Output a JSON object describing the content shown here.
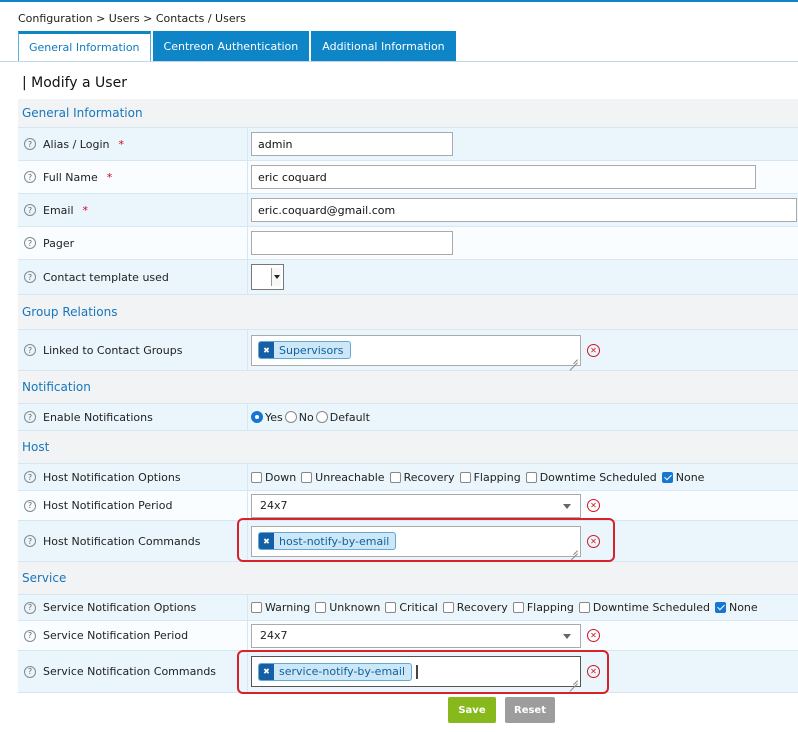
{
  "breadcrumb": "Configuration > Users > Contacts / Users",
  "tabs": [
    {
      "label": "General Information"
    },
    {
      "label": "Centreon Authentication"
    },
    {
      "label": "Additional Information"
    }
  ],
  "page_title": "| Modify a User",
  "sections": {
    "general": "General Information",
    "group": "Group Relations",
    "notification": "Notification",
    "host": "Host",
    "service": "Service"
  },
  "fields": {
    "alias": {
      "label": "Alias / Login",
      "value": "admin",
      "required": "*"
    },
    "full_name": {
      "label": "Full Name",
      "value": "eric coquard",
      "required": "*"
    },
    "email": {
      "label": "Email",
      "value": "eric.coquard@gmail.com",
      "required": "*"
    },
    "pager": {
      "label": "Pager",
      "value": ""
    },
    "template": {
      "label": "Contact template used"
    },
    "contact_groups": {
      "label": "Linked to Contact Groups",
      "tag": "Supervisors"
    },
    "enable_notifications": {
      "label": "Enable Notifications",
      "options": [
        "Yes",
        "No",
        "Default"
      ],
      "selected": "Yes"
    },
    "host_options": {
      "label": "Host Notification Options",
      "options": [
        "Down",
        "Unreachable",
        "Recovery",
        "Flapping",
        "Downtime Scheduled",
        "None"
      ],
      "checked": [
        "None"
      ]
    },
    "host_period": {
      "label": "Host Notification Period",
      "value": "24x7"
    },
    "host_commands": {
      "label": "Host Notification Commands",
      "tag": "host-notify-by-email"
    },
    "service_options": {
      "label": "Service Notification Options",
      "options": [
        "Warning",
        "Unknown",
        "Critical",
        "Recovery",
        "Flapping",
        "Downtime Scheduled",
        "None"
      ],
      "checked": [
        "None"
      ]
    },
    "service_period": {
      "label": "Service Notification Period",
      "value": "24x7"
    },
    "service_commands": {
      "label": "Service Notification Commands",
      "tag": "service-notify-by-email"
    }
  },
  "buttons": {
    "save": "Save",
    "reset": "Reset"
  },
  "colors": {
    "accent": "#0e85c7",
    "save": "#87b81c",
    "reset": "#9d9d9d",
    "highlight": "#d8222a"
  }
}
